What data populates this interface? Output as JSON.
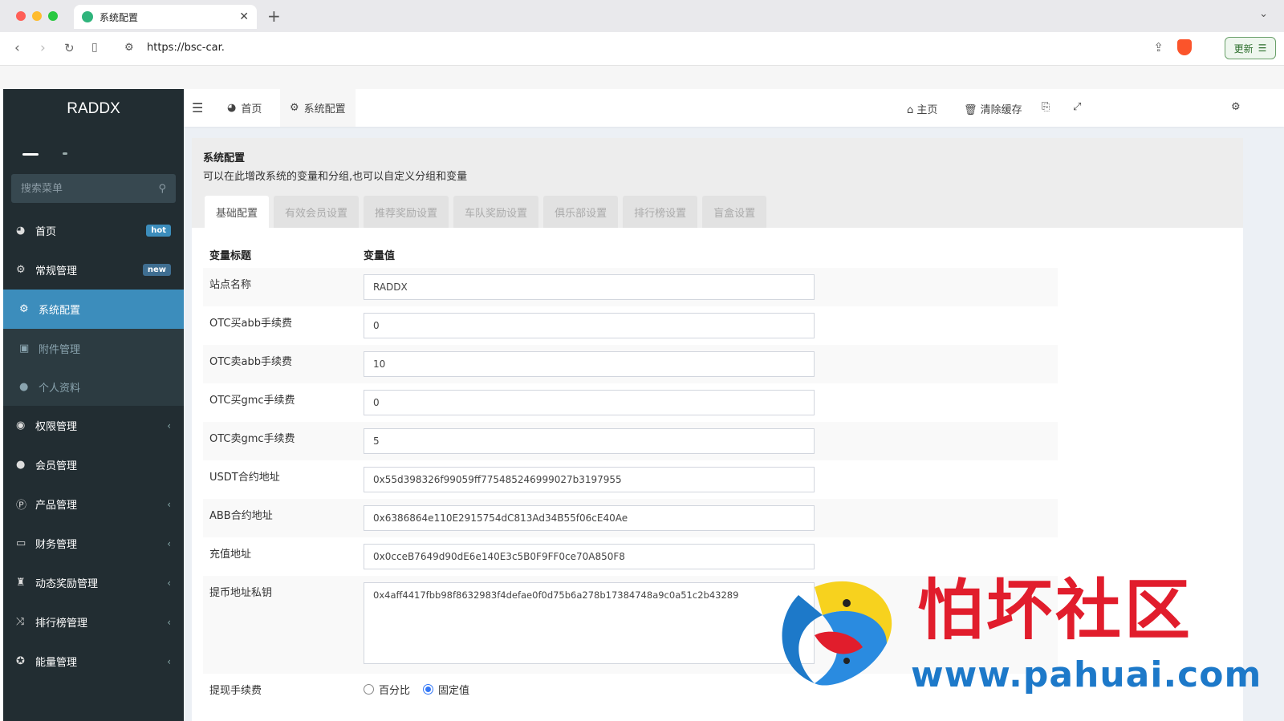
{
  "browser": {
    "tab_title": "系统配置",
    "url": "https://bsc-car.",
    "update_label": "更新"
  },
  "sidebar": {
    "logo": "RADDX",
    "search_placeholder": "搜索菜单",
    "items": [
      {
        "label": "首页",
        "icon": "dashboard-icon",
        "badge": "hot"
      },
      {
        "label": "常规管理",
        "icon": "cogs-icon",
        "badge": "new"
      },
      {
        "label": "系统配置",
        "icon": "gear-icon",
        "active": true
      },
      {
        "label": "附件管理",
        "icon": "file-image-icon",
        "sub": true
      },
      {
        "label": "个人资料",
        "icon": "user-icon",
        "sub": true
      },
      {
        "label": "权限管理",
        "icon": "group-icon",
        "chevron": true
      },
      {
        "label": "会员管理",
        "icon": "user-icon"
      },
      {
        "label": "产品管理",
        "icon": "product-icon",
        "chevron": true
      },
      {
        "label": "财务管理",
        "icon": "credit-card-icon",
        "chevron": true
      },
      {
        "label": "动态奖励管理",
        "icon": "trophy-icon",
        "chevron": true
      },
      {
        "label": "排行榜管理",
        "icon": "random-icon",
        "chevron": true
      },
      {
        "label": "能量管理",
        "icon": "energy-icon",
        "chevron": true
      }
    ]
  },
  "topbar": {
    "tabs": [
      {
        "label": "首页",
        "icon": "dashboard-icon"
      },
      {
        "label": "系统配置",
        "icon": "gear-icon"
      }
    ],
    "home_label": "主页",
    "clear_cache_label": "清除缓存"
  },
  "page": {
    "title": "系统配置",
    "description": "可以在此增改系统的变量和分组,也可以自定义分组和变量",
    "subtabs": [
      "基础配置",
      "有效会员设置",
      "推荐奖励设置",
      "车队奖励设置",
      "俱乐部设置",
      "排行榜设置",
      "盲盒设置"
    ],
    "col_key": "变量标题",
    "col_value": "变量值",
    "rows": [
      {
        "key": "站点名称",
        "value": "RADDX"
      },
      {
        "key": "OTC买abb手续费",
        "value": "0"
      },
      {
        "key": "OTC卖abb手续费",
        "value": "10"
      },
      {
        "key": "OTC买gmc手续费",
        "value": "0"
      },
      {
        "key": "OTC卖gmc手续费",
        "value": "5"
      },
      {
        "key": "USDT合约地址",
        "value": "0x55d398326f99059ff775485246999027b3197955"
      },
      {
        "key": "ABB合约地址",
        "value": "0x6386864e110E2915754dC813Ad34B55f06cE40Ae"
      },
      {
        "key": "充值地址",
        "value": "0x0cceB7649d90dE6e140E3c5B0F9FF0ce70A850F8"
      }
    ],
    "private_key_label": "提币地址私钥",
    "private_key_value": "0x4aff4417fbb98f8632983f4defae0f0d75b6a278b17384748a9c0a51c2b43289",
    "fee_label": "提现手续费",
    "fee_options": [
      "百分比",
      "固定值"
    ],
    "fee_selected": "固定值"
  },
  "watermark": {
    "cn": "怕坏社区",
    "en": "www.pahuai.com"
  }
}
